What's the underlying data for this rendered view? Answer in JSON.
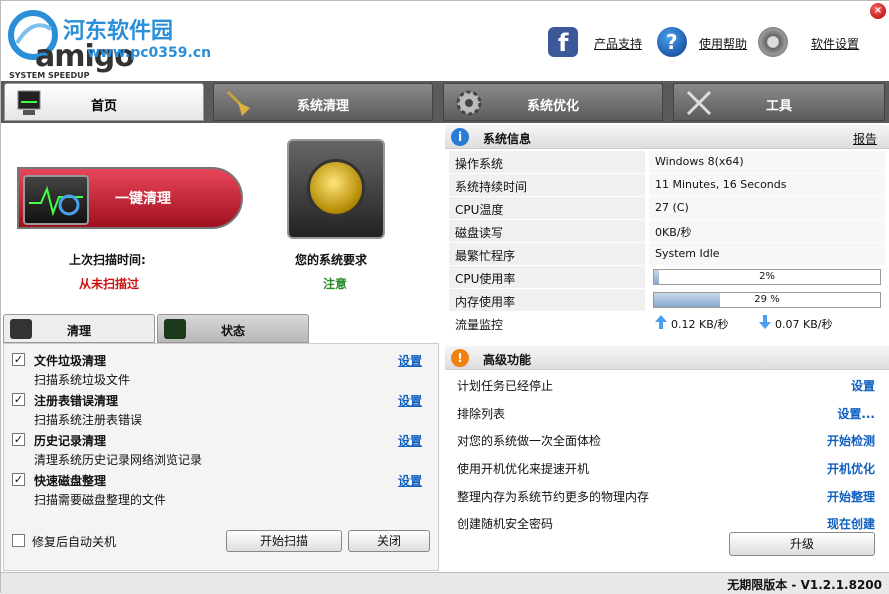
{
  "watermark": {
    "site_name": "河东软件园",
    "url": "www.pc0359.cn",
    "brand": "amigo",
    "brand_sub": "SYSTEM SPEEDUP"
  },
  "header": {
    "product_support": "产品支持",
    "help": "使用帮助",
    "settings": "软件设置"
  },
  "tabs": [
    {
      "label": "首页",
      "icon": "monitor-icon"
    },
    {
      "label": "系统清理",
      "icon": "broom-icon"
    },
    {
      "label": "系统优化",
      "icon": "gear-icon"
    },
    {
      "label": "工具",
      "icon": "tools-icon"
    }
  ],
  "home": {
    "one_click_clean": "一键清理",
    "last_scan_label": "上次扫描时间:",
    "last_scan_value": "从未扫描过",
    "system_req_label": "您的系统要求",
    "system_req_value": "注意"
  },
  "subtabs": {
    "clean": "清理",
    "status": "状态"
  },
  "clean_items": [
    {
      "title": "文件垃圾清理",
      "desc": "扫描系统垃圾文件",
      "settings": "设置",
      "checked": true
    },
    {
      "title": "注册表错误清理",
      "desc": "扫描系统注册表错误",
      "settings": "设置",
      "checked": true
    },
    {
      "title": "历史记录清理",
      "desc": "清理系统历史记录网络浏览记录",
      "settings": "设置",
      "checked": true
    },
    {
      "title": "快速磁盘整理",
      "desc": "扫描需要磁盘整理的文件",
      "settings": "设置",
      "checked": true
    }
  ],
  "shutdown_after": {
    "label": "修复后自动关机",
    "checked": false
  },
  "buttons": {
    "start_scan": "开始扫描",
    "close": "关闭",
    "upgrade": "升级"
  },
  "sysinfo": {
    "title": "系统信息",
    "report": "报告",
    "rows": [
      {
        "key": "操作系统",
        "value": "Windows 8(x64)"
      },
      {
        "key": "系统持续时间",
        "value": "11 Minutes, 16 Seconds"
      },
      {
        "key": "CPU温度",
        "value": "27 (C)"
      },
      {
        "key": "磁盘读写",
        "value": "0KB/秒"
      },
      {
        "key": "最繁忙程序",
        "value": "System Idle"
      }
    ],
    "cpu": {
      "key": "CPU使用率",
      "text": "2%",
      "percent": 2
    },
    "mem": {
      "key": "内存使用率",
      "text": "29 %",
      "percent": 29
    },
    "traffic": {
      "key": "流量监控",
      "up": "0.12 KB/秒",
      "down": "0.07 KB/秒"
    }
  },
  "advanced": {
    "title": "高级功能",
    "rows": [
      {
        "label": "计划任务已经停止",
        "action": "设置"
      },
      {
        "label": "排除列表",
        "action": "设置..."
      },
      {
        "label": "对您的系统做一次全面体检",
        "action": "开始检测"
      },
      {
        "label": "使用开机优化来提速开机",
        "action": "开机优化"
      },
      {
        "label": "整理内存为系统节约更多的物理内存",
        "action": "开始整理"
      },
      {
        "label": "创建随机安全密码",
        "action": "现在创建"
      }
    ]
  },
  "status": {
    "version": "无期限版本 - V1.2.1.8200"
  },
  "colors": {
    "accent": "#1060c0",
    "danger": "#d01010",
    "ok": "#2a8a2a"
  }
}
